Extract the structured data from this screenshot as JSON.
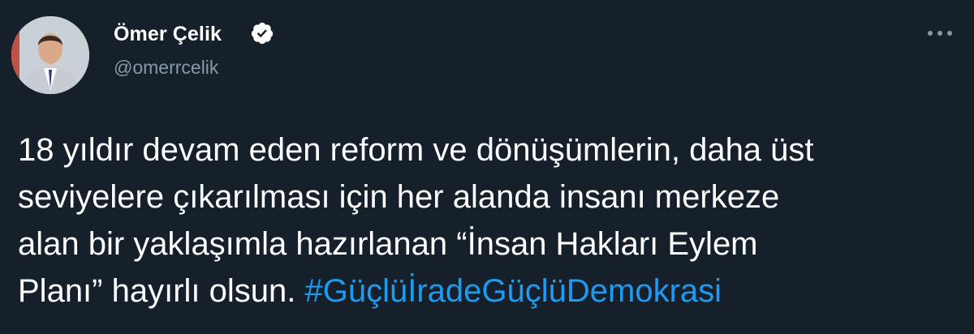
{
  "author": {
    "name": "Ömer Çelik",
    "handle": "@omerrcelik",
    "verified": true
  },
  "menu": {
    "more_icon": "more-horizontal-icon"
  },
  "tweet": {
    "lines": [
      "18 yıldır devam eden reform ve dönüşümlerin, daha üst",
      "seviyelere çıkarılması için her alanda insanı merkeze",
      "alan bir yaklaşımla hazırlanan “İnsan Hakları Eylem",
      "Planı” hayırlı olsun. "
    ],
    "hashtag": "#GüçlüİradeGüçlüDemokrasi"
  },
  "colors": {
    "background": "#15202b",
    "text": "#ffffff",
    "secondary_text": "#8899a6",
    "link": "#1d9bf0"
  }
}
